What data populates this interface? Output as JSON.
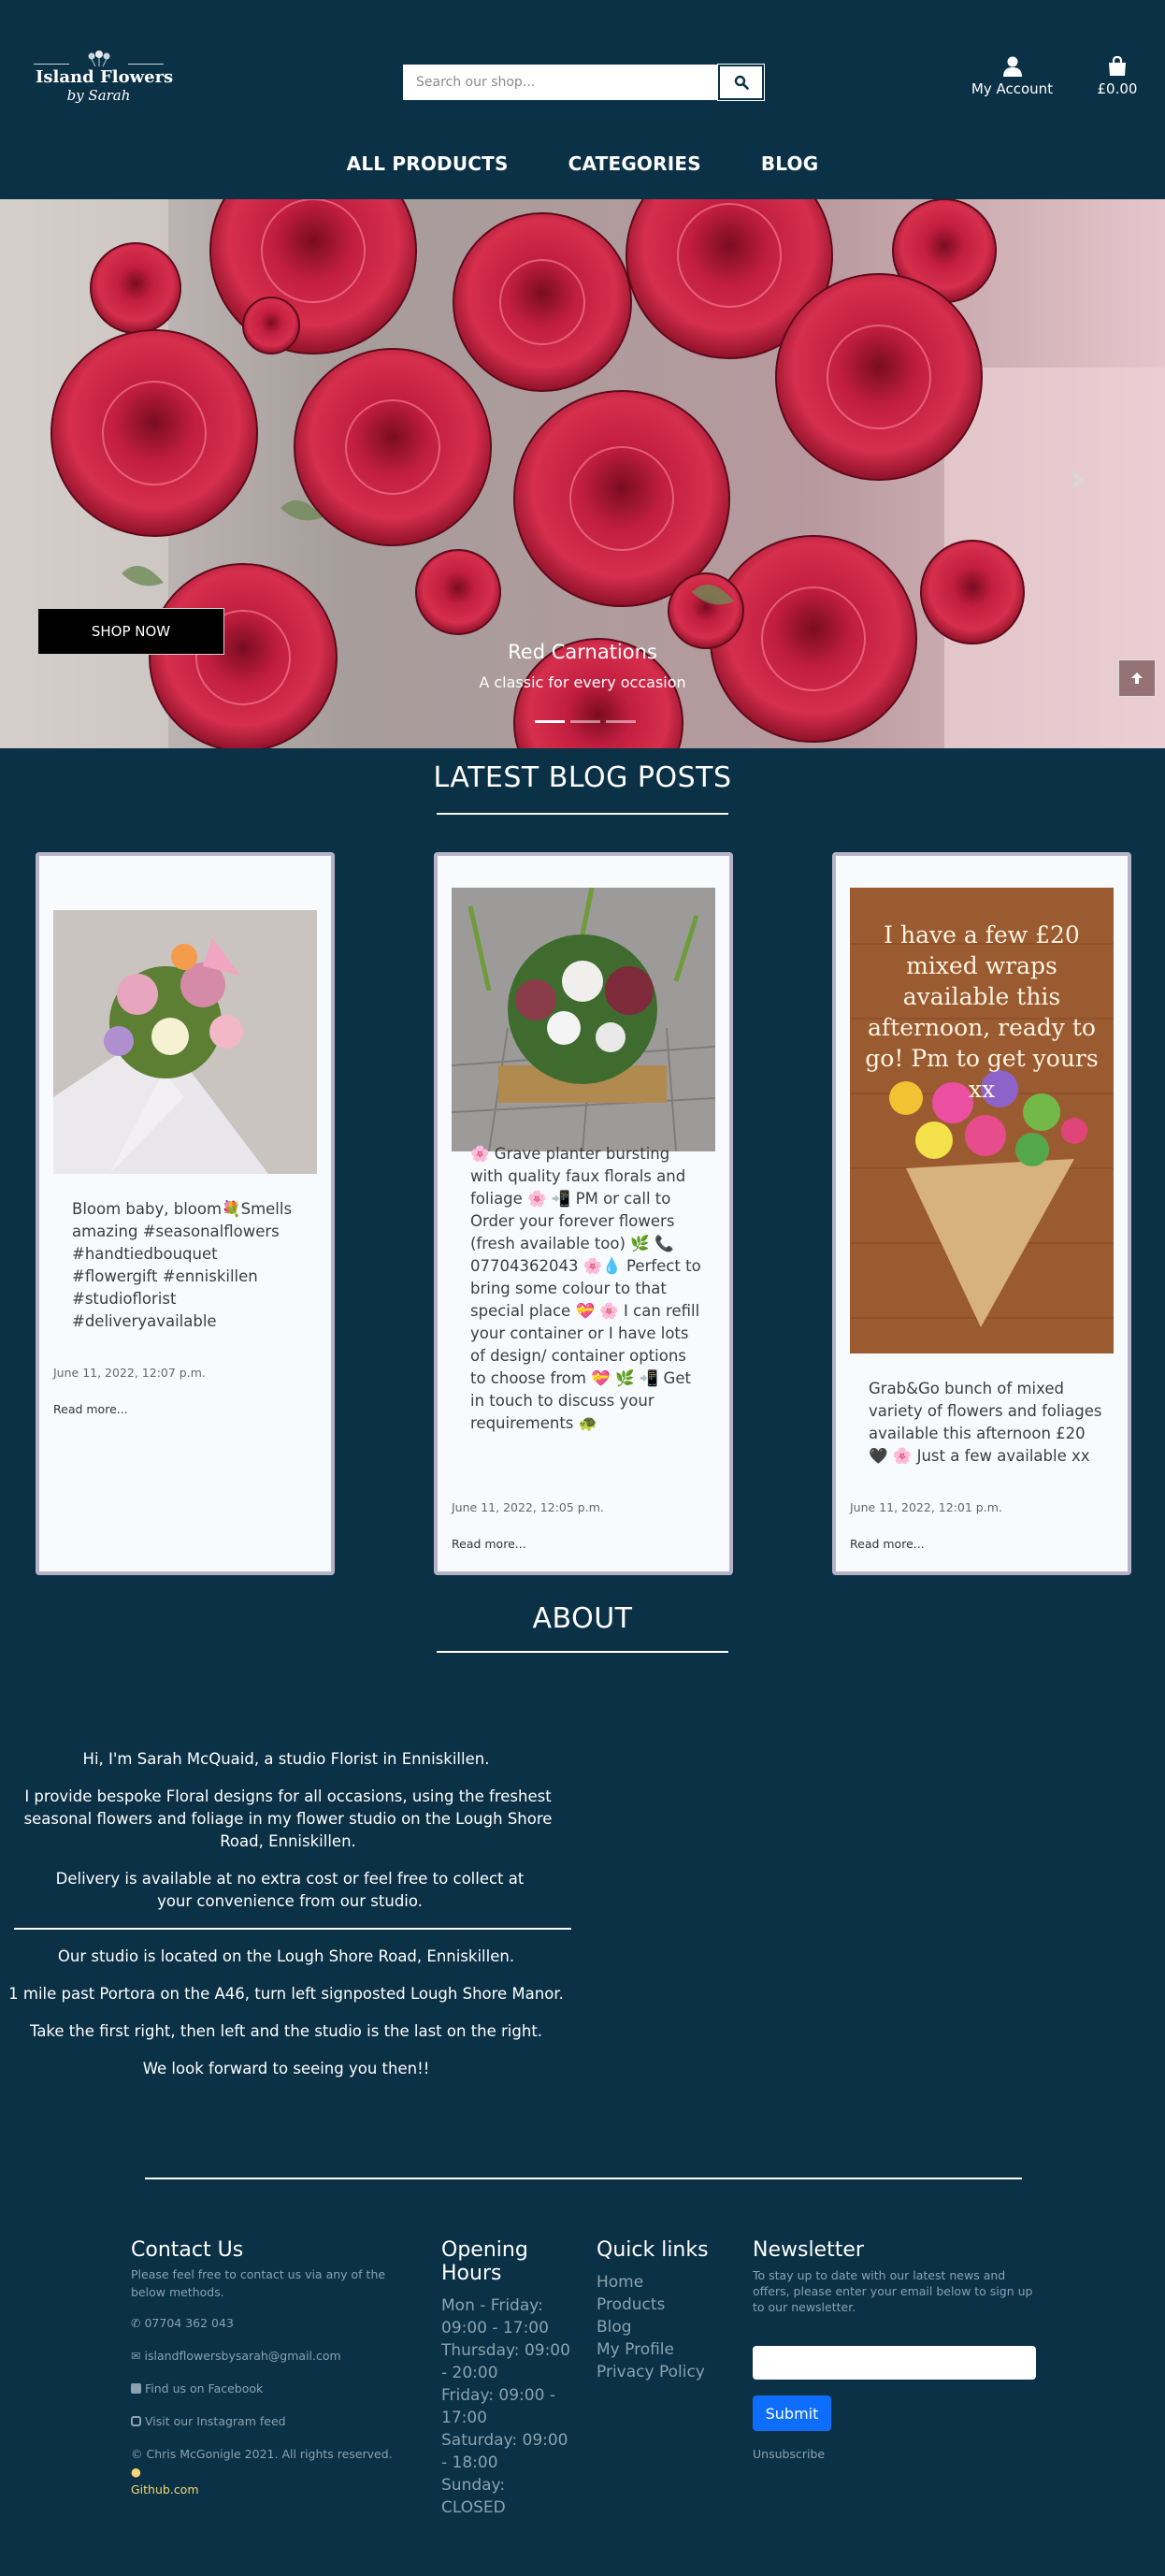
{
  "header": {
    "logo_line1": "Island Flowers",
    "logo_line2": "by Sarah",
    "search_placeholder": "Search our shop...",
    "account_label": "My Account",
    "bag_total": "£0.00"
  },
  "nav": [
    "ALL PRODUCTS",
    "CATEGORIES",
    "BLOG"
  ],
  "hero": {
    "button": "SHOP NOW",
    "title": "Red Carnations",
    "subtitle": "A classic for every occasion",
    "slides": 3,
    "active_slide": 1
  },
  "blog": {
    "title": "LATEST BLOG POSTS",
    "posts": [
      {
        "text": "Bloom baby, bloom💐Smells amazing #seasonalflowers #handtiedbouquet #flowergift #enniskillen #studioflorist #deliveryavailable",
        "date": "June 11, 2022, 12:07 p.m.",
        "more": "Read more..."
      },
      {
        "text": "🌸 Grave planter bursting with quality faux florals and foliage 🌸 📲 PM or call to Order your forever flowers (fresh available too) 🌿 📞 07704362043 🌸💧 Perfect to bring some colour to that special place 💝 🌸 I can refill your container or I have lots of design/ container options to choose from 💝 🌿 📲 Get in touch to discuss your requirements 🐢",
        "date": "June 11, 2022, 12:05 p.m.",
        "more": "Read more..."
      },
      {
        "image_text": "I have a few £20 mixed wraps available this afternoon, ready to go! Pm to get yours xx",
        "text": "Grab&Go bunch of mixed variety of flowers and foliages available this afternoon £20 🖤 🌸 Just a few available xx",
        "date": "June 11, 2022, 12:01 p.m.",
        "more": "Read more..."
      }
    ]
  },
  "about": {
    "title": "ABOUT",
    "p1": "Hi, I'm Sarah McQuaid, a studio Florist in Enniskillen.",
    "p2": "I provide bespoke Floral designs for all occasions, using the freshest seasonal flowers and foliage in my flower studio on the Lough Shore Road, Enniskillen.",
    "p3": "Delivery is available at no extra cost or feel free to collect at your convenience from our studio.",
    "p4": "Our studio is located on the Lough Shore Road, Enniskillen.",
    "p5": "1 mile past Portora on the A46, turn left signposted Lough Shore Manor.",
    "p6": "Take the first right, then left and the studio is the last on the right.",
    "p7": "We look forward to seeing you then!!"
  },
  "footer": {
    "contact_title": "Contact Us",
    "contact_intro": "Please feel free to contact us via any of the below methods.",
    "phone": "07704 362 043",
    "email": "islandflowersbysarah@gmail.com",
    "facebook": "Find us on Facebook",
    "instagram": "Visit our Instagram feed",
    "copyright": "© Chris McGonigle 2021. All rights reserved.",
    "github": "Github.com",
    "hours_title": "Opening Hours",
    "hours": [
      "Mon - Friday: 09:00 - 17:00",
      "Thursday: 09:00 - 20:00",
      "Friday: 09:00 - 17:00",
      "Saturday: 09:00 - 18:00",
      "Sunday: CLOSED"
    ],
    "links_title": "Quick links",
    "links": [
      "Home",
      "Products",
      "Blog",
      "My Profile",
      "Privacy Policy"
    ],
    "newsletter_title": "Newsletter",
    "newsletter_text": "To stay up to date with our latest news and offers, please enter your email below to sign up to our newsletter.",
    "submit": "Submit",
    "unsubscribe": "Unsubscribe"
  },
  "colors": {
    "background": "#0b3146",
    "card_bg": "#f7fbfd",
    "card_border": "#b6b3c9",
    "submit_blue": "#0d6efd",
    "github_yellow": "#f7d774"
  }
}
